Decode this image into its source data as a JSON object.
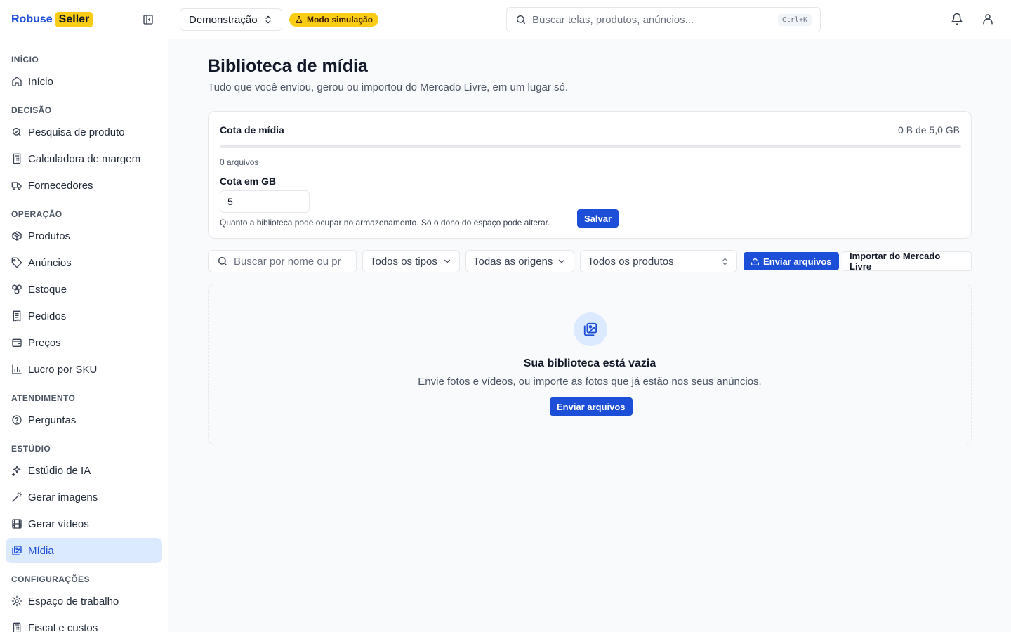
{
  "brand": {
    "name_part1": "Robuse",
    "name_part2": "Seller"
  },
  "sidebar": {
    "sections": [
      {
        "title": "INÍCIO",
        "items": [
          {
            "label": "Início",
            "icon": "home-icon"
          }
        ]
      },
      {
        "title": "DECISÃO",
        "items": [
          {
            "label": "Pesquisa de produto",
            "icon": "search-zoom-icon"
          },
          {
            "label": "Calculadora de margem",
            "icon": "calculator-icon"
          },
          {
            "label": "Fornecedores",
            "icon": "truck-icon"
          }
        ]
      },
      {
        "title": "OPERAÇÃO",
        "items": [
          {
            "label": "Produtos",
            "icon": "package-icon"
          },
          {
            "label": "Anúncios",
            "icon": "tag-icon"
          },
          {
            "label": "Estoque",
            "icon": "boxes-icon"
          },
          {
            "label": "Pedidos",
            "icon": "receipt-icon"
          },
          {
            "label": "Preços",
            "icon": "wallet-icon"
          },
          {
            "label": "Lucro por SKU",
            "icon": "bar-chart-icon"
          }
        ]
      },
      {
        "title": "ATENDIMENTO",
        "items": [
          {
            "label": "Perguntas",
            "icon": "help-circle-icon"
          }
        ]
      },
      {
        "title": "ESTÚDIO",
        "items": [
          {
            "label": "Estúdio de IA",
            "icon": "sparkles-icon"
          },
          {
            "label": "Gerar imagens",
            "icon": "wand-icon"
          },
          {
            "label": "Gerar vídeos",
            "icon": "film-icon"
          },
          {
            "label": "Mídia",
            "icon": "images-icon",
            "active": true
          }
        ]
      },
      {
        "title": "CONFIGURAÇÕES",
        "items": [
          {
            "label": "Espaço de trabalho",
            "icon": "gear-icon"
          },
          {
            "label": "Fiscal e custos",
            "icon": "calculator-icon"
          }
        ]
      }
    ]
  },
  "topbar": {
    "workspace": "Demonstração",
    "badge": "Modo simulação",
    "search_placeholder": "Buscar telas, produtos, anúncios...",
    "search_shortcut": "Ctrl+K"
  },
  "page": {
    "title": "Biblioteca de mídia",
    "subtitle": "Tudo que você enviou, gerou ou importou do Mercado Livre, em um lugar só."
  },
  "quota": {
    "title": "Cota de mídia",
    "usage": "0 B de 5,0 GB",
    "used_fraction": 0,
    "files": "0 arquivos",
    "input_label": "Cota em GB",
    "input_value": "5",
    "help": "Quanto a biblioteca pode ocupar no armazenamento. Só o dono do espaço pode alterar.",
    "save_label": "Salvar"
  },
  "filters": {
    "search_placeholder": "Buscar por nome ou pr",
    "types": "Todos os tipos",
    "origins": "Todas as origens",
    "products": "Todos os produtos",
    "upload_label": "Enviar arquivos",
    "import_label": "Importar do Mercado Livre"
  },
  "empty": {
    "title": "Sua biblioteca está vazia",
    "subtitle": "Envie fotos e vídeos, ou importe as fotos que já estão nos seus anúncios.",
    "button": "Enviar arquivos"
  },
  "colors": {
    "accent": "#1d4ed8",
    "badge": "#facc15",
    "active_bg": "#dbeafe"
  }
}
